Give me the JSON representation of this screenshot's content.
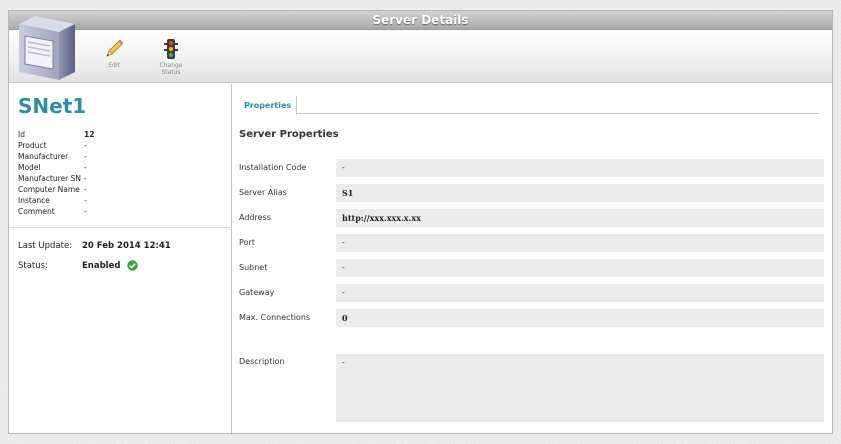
{
  "window": {
    "title": "Server Details"
  },
  "toolbar": {
    "edit_label": "Edit",
    "change_status_label_1": "Change",
    "change_status_label_2": "Status"
  },
  "server": {
    "name": "SNet1",
    "attributes": [
      {
        "label": "Id",
        "value": "12"
      },
      {
        "label": "Product",
        "value": "-"
      },
      {
        "label": "Manufacturer",
        "value": "-"
      },
      {
        "label": "Model",
        "value": "-"
      },
      {
        "label": "Manufacturer SN",
        "value": "-"
      },
      {
        "label": "Computer Name",
        "value": "-"
      },
      {
        "label": "Instance",
        "value": "-"
      },
      {
        "label": "Comment",
        "value": "-"
      }
    ],
    "last_update_label": "Last Update:",
    "last_update_value": "20 Feb 2014 12:41",
    "status_label": "Status:",
    "status_value": "Enabled"
  },
  "tabs": [
    {
      "label": "Properties"
    }
  ],
  "properties": {
    "section_title": "Server Properties",
    "fields": [
      {
        "label": "Installation Code",
        "value": "-"
      },
      {
        "label": "Server Alias",
        "value": "S1"
      },
      {
        "label": "Address",
        "value": "http://xxx.xxx.x.xx"
      },
      {
        "label": "Port",
        "value": "-"
      },
      {
        "label": "Subnet",
        "value": "-"
      },
      {
        "label": "Gateway",
        "value": "-"
      },
      {
        "label": "Max. Connections",
        "value": "0"
      },
      {
        "label": "Description",
        "value": "-"
      }
    ]
  },
  "colors": {
    "accent": "#2d8fa6",
    "field_bg": "#ececec",
    "status_ok": "#3aa335"
  }
}
